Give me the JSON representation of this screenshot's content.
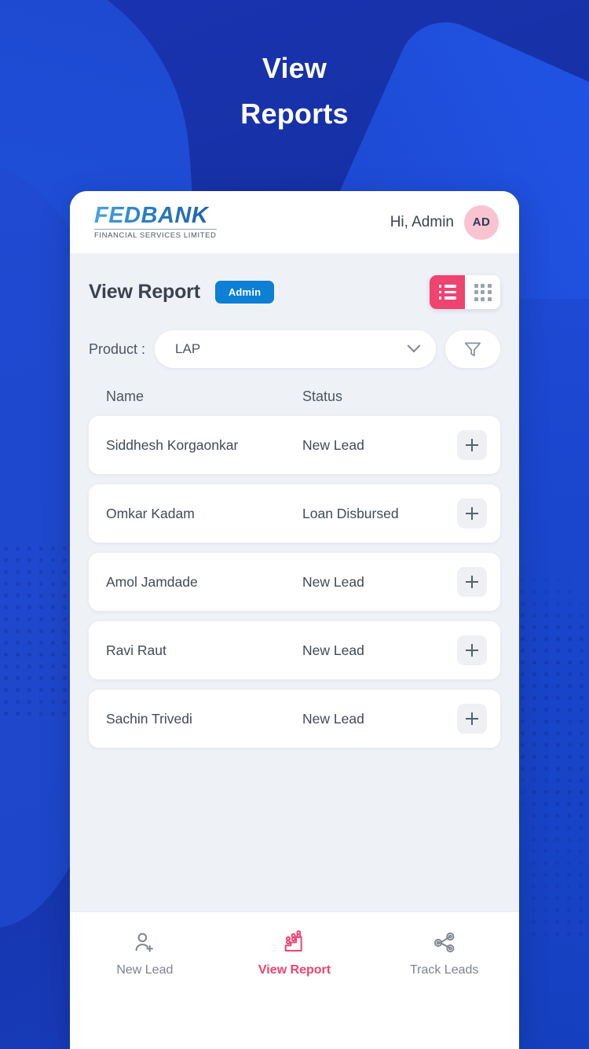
{
  "hero": {
    "line1": "View",
    "line2": "Reports"
  },
  "app_header": {
    "brand_name": "FEDBANK",
    "brand_tagline": "FINANCIAL SERVICES LIMITED",
    "greeting": "Hi, Admin",
    "avatar_initials": "AD"
  },
  "page": {
    "title": "View Report",
    "role_badge": "Admin"
  },
  "view_toggle": {
    "list_label": "list-view",
    "grid_label": "grid-view",
    "active": "list",
    "active_color": "#ef4370"
  },
  "filters": {
    "product_label": "Product :",
    "product_value": "LAP",
    "product_options": [
      "LAP"
    ],
    "filter_icon": "funnel-icon"
  },
  "table": {
    "columns": [
      "Name",
      "Status"
    ],
    "rows": [
      {
        "name": "Siddhesh Korgaonkar",
        "status": "New Lead",
        "action": "+"
      },
      {
        "name": "Omkar Kadam",
        "status": "Loan Disbursed",
        "action": "+"
      },
      {
        "name": "Amol Jamdade",
        "status": "New Lead",
        "action": "+"
      },
      {
        "name": "Ravi Raut",
        "status": "New Lead",
        "action": "+"
      },
      {
        "name": "Sachin Trivedi",
        "status": "New Lead",
        "action": "+"
      }
    ]
  },
  "bottom_nav": {
    "items": [
      {
        "label": "New Lead",
        "icon": "user-add-icon",
        "active": false
      },
      {
        "label": "View Report",
        "icon": "bar-chart-icon",
        "active": true
      },
      {
        "label": "Track Leads",
        "icon": "share-network-icon",
        "active": false
      }
    ]
  },
  "colors": {
    "background_blue": "#1c37b5",
    "accent_pink": "#ef4370",
    "badge_blue": "#0d7fd4",
    "avatar_pink": "#f9c3d2"
  }
}
